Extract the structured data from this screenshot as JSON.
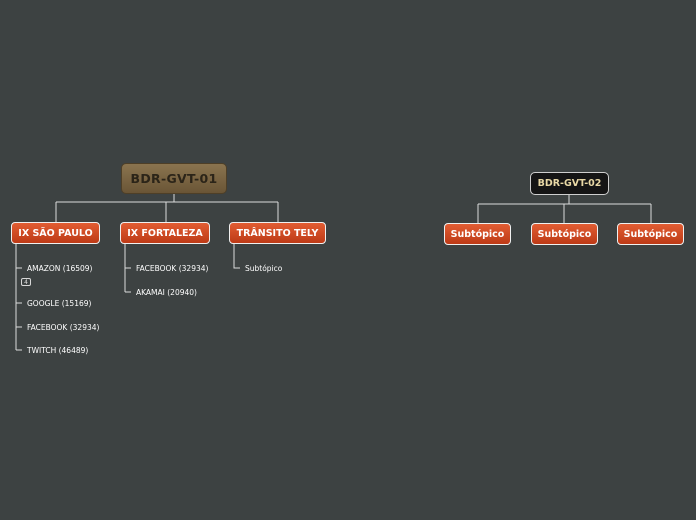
{
  "map1": {
    "root": "BDR-GVT-01",
    "topics": [
      {
        "label": "IX SÃO PAULO",
        "children": [
          "AMAZON (16509)",
          "GOOGLE (15169)",
          "FACEBOOK (32934)",
          "TWITCH (46489)"
        ],
        "collapsed_count": "4"
      },
      {
        "label": "IX FORTALEZA",
        "children": [
          "FACEBOOK (32934)",
          "AKAMAI (20940)"
        ]
      },
      {
        "label": "TRÂNSITO TELY",
        "children": [
          "Subtópico"
        ]
      }
    ]
  },
  "map2": {
    "root": "BDR-GVT-02",
    "topics": [
      "Subtópico",
      "Subtópico",
      "Subtópico"
    ]
  },
  "colors": {
    "background": "#3d4242",
    "topic_fill": "#d24a22",
    "root1_fill": "#7a6443",
    "root2_fill": "#151515",
    "root2_text": "#e9d9a6",
    "connector": "#e0e0e0"
  }
}
